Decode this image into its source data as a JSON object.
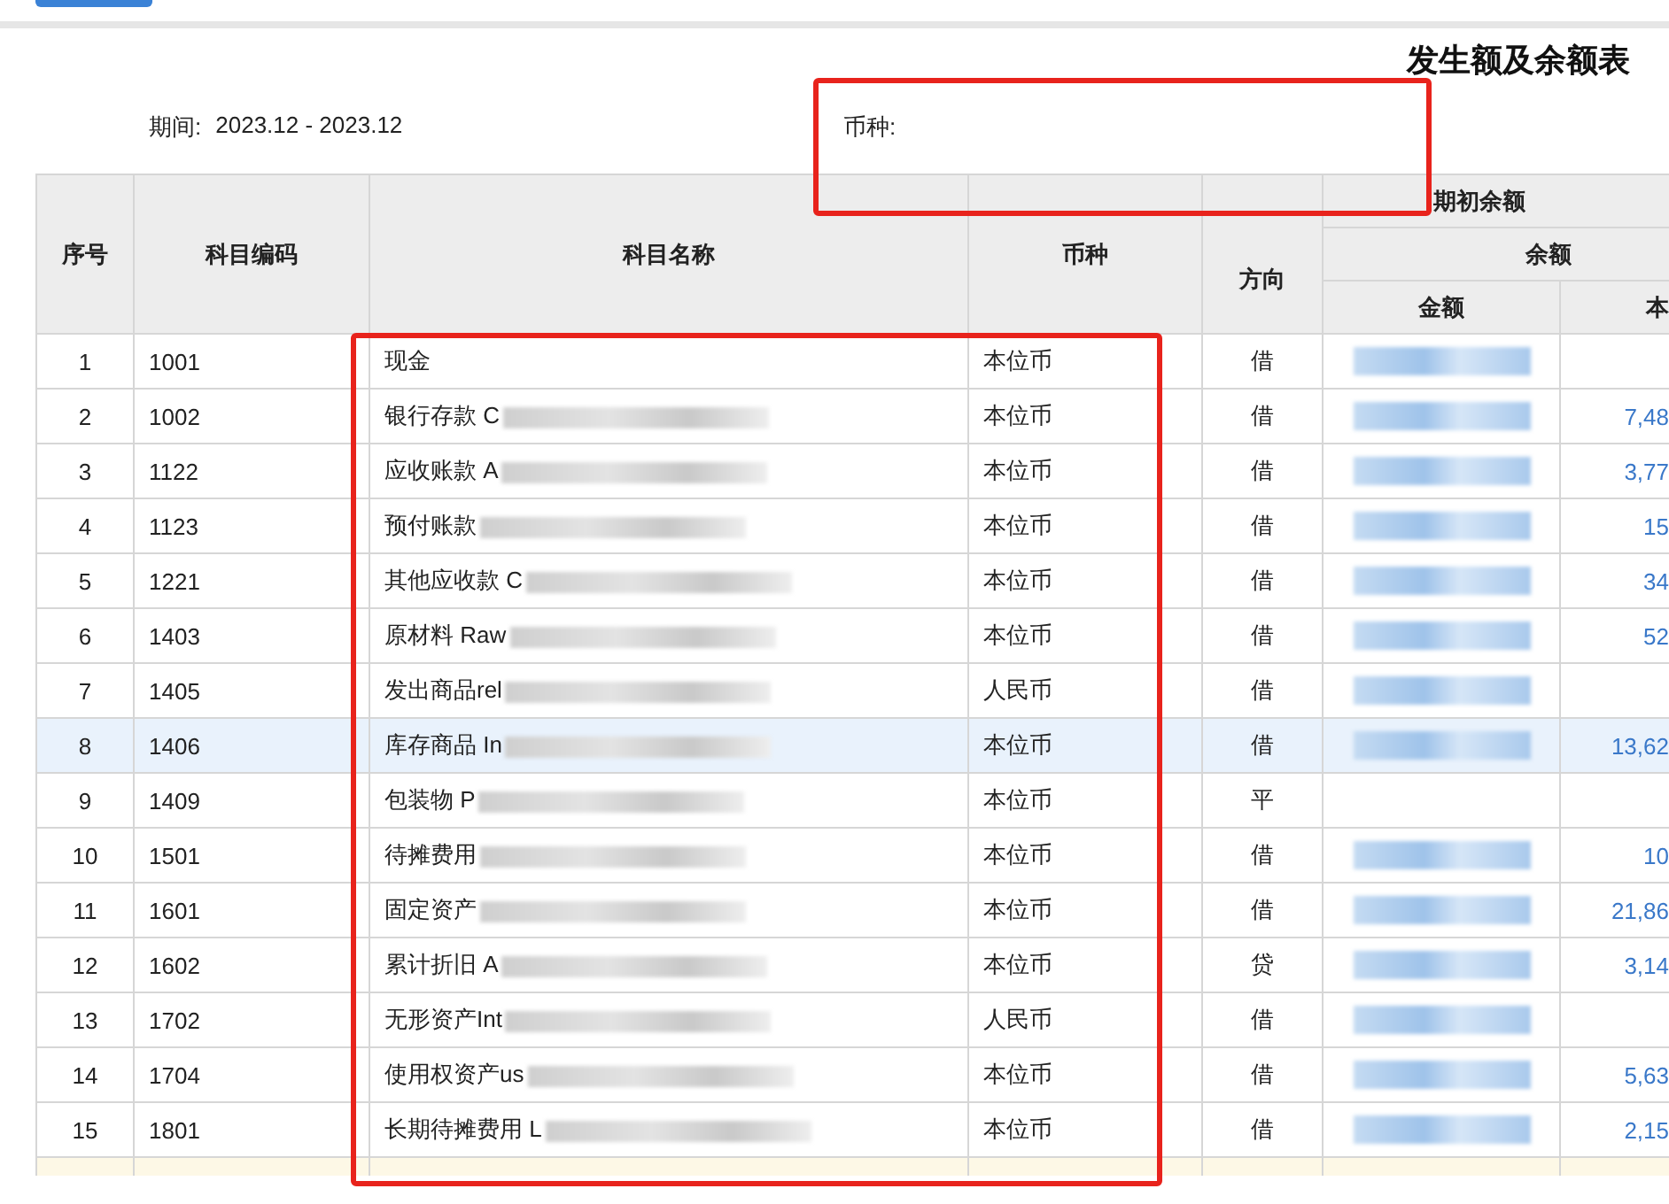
{
  "report": {
    "title": "发生额及余额表",
    "period_label": "期间:",
    "period_value": "2023.12 - 2023.12",
    "currency_label": "币种:"
  },
  "table": {
    "columns": {
      "index": "序号",
      "code": "科目编码",
      "name": "科目名称",
      "currency": "币种",
      "direction": "方向",
      "opening": "期初余额",
      "balance": "余额",
      "amount": "金额",
      "column_8": "本"
    },
    "rows": [
      {
        "index": "1",
        "code": "1001",
        "name": "现金",
        "name_redacted": false,
        "currency": "本位币",
        "direction": "借",
        "amount_redacted": true,
        "column_8": "",
        "selected": false
      },
      {
        "index": "2",
        "code": "1002",
        "name": "银行存款 C",
        "name_redacted": true,
        "currency": "本位币",
        "direction": "借",
        "amount_redacted": true,
        "column_8": "7,48",
        "selected": false
      },
      {
        "index": "3",
        "code": "1122",
        "name": "应收账款 A",
        "name_redacted": true,
        "currency": "本位币",
        "direction": "借",
        "amount_redacted": true,
        "column_8": "3,77",
        "selected": false
      },
      {
        "index": "4",
        "code": "1123",
        "name": "预付账款",
        "name_redacted": true,
        "currency": "本位币",
        "direction": "借",
        "amount_redacted": true,
        "column_8": "15",
        "selected": false
      },
      {
        "index": "5",
        "code": "1221",
        "name": "其他应收款 C",
        "name_redacted": true,
        "currency": "本位币",
        "direction": "借",
        "amount_redacted": true,
        "column_8": "34",
        "selected": false
      },
      {
        "index": "6",
        "code": "1403",
        "name": "原材料 Raw",
        "name_redacted": true,
        "currency": "本位币",
        "direction": "借",
        "amount_redacted": true,
        "column_8": "52",
        "selected": false
      },
      {
        "index": "7",
        "code": "1405",
        "name": "发出商品rel",
        "name_redacted": true,
        "currency": "人民币",
        "direction": "借",
        "amount_redacted": true,
        "column_8": "",
        "selected": false
      },
      {
        "index": "8",
        "code": "1406",
        "name": "库存商品 In",
        "name_redacted": true,
        "currency": "本位币",
        "direction": "借",
        "amount_redacted": true,
        "column_8": "13,62",
        "selected": true
      },
      {
        "index": "9",
        "code": "1409",
        "name": "包装物 P",
        "name_redacted": true,
        "currency": "本位币",
        "direction": "平",
        "amount_redacted": false,
        "column_8": "",
        "selected": false
      },
      {
        "index": "10",
        "code": "1501",
        "name": "待摊费用",
        "name_redacted": true,
        "currency": "本位币",
        "direction": "借",
        "amount_redacted": true,
        "column_8": "10",
        "selected": false
      },
      {
        "index": "11",
        "code": "1601",
        "name": "固定资产",
        "name_redacted": true,
        "currency": "本位币",
        "direction": "借",
        "amount_redacted": true,
        "column_8": "21,86",
        "selected": false
      },
      {
        "index": "12",
        "code": "1602",
        "name": "累计折旧 A",
        "name_redacted": true,
        "currency": "本位币",
        "direction": "贷",
        "amount_redacted": true,
        "column_8": "3,14",
        "selected": false
      },
      {
        "index": "13",
        "code": "1702",
        "name": "无形资产Int",
        "name_redacted": true,
        "currency": "人民币",
        "direction": "借",
        "amount_redacted": true,
        "column_8": "",
        "selected": false
      },
      {
        "index": "14",
        "code": "1704",
        "name": "使用权资产us",
        "name_redacted": true,
        "currency": "本位币",
        "direction": "借",
        "amount_redacted": true,
        "column_8": "5,63",
        "selected": false
      },
      {
        "index": "15",
        "code": "1801",
        "name": "长期待摊费用 L",
        "name_redacted": true,
        "currency": "本位币",
        "direction": "借",
        "amount_redacted": true,
        "column_8": "2,15",
        "selected": false
      }
    ],
    "subtotal_row_visible": true
  },
  "highlights": {
    "currency_filter": true,
    "name_currency_columns": true
  }
}
